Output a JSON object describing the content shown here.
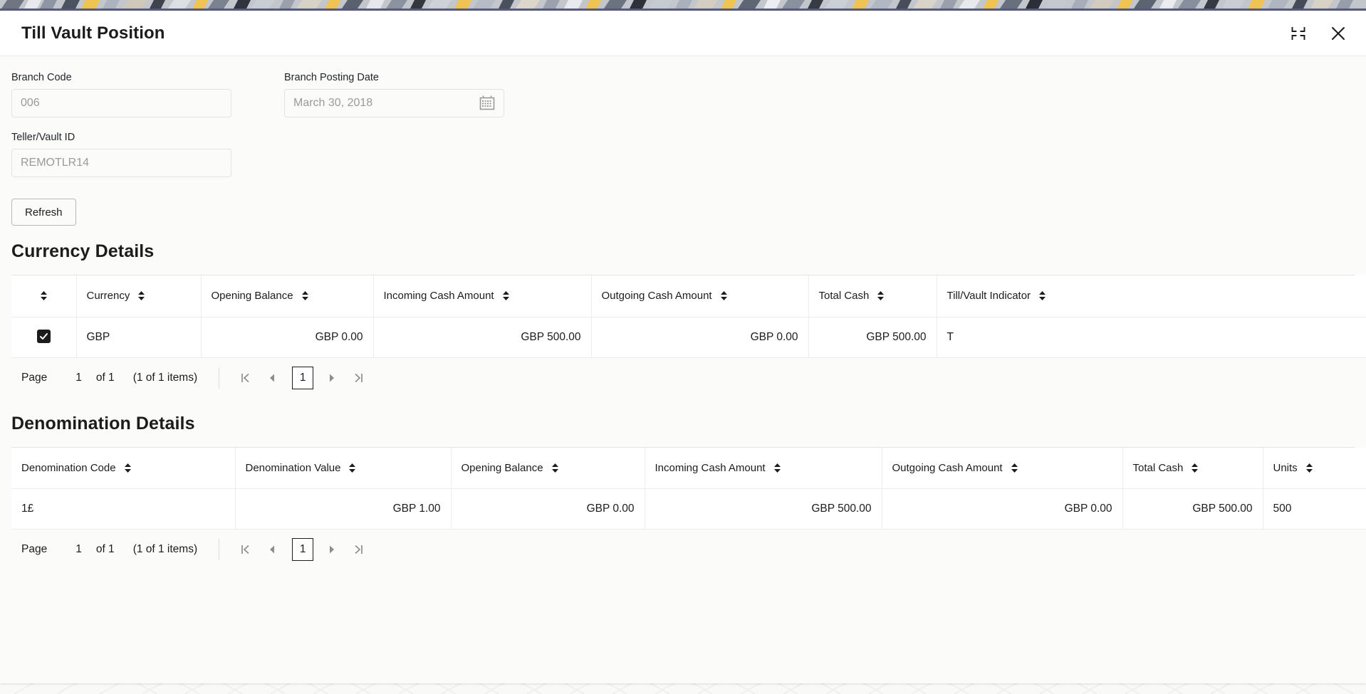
{
  "window": {
    "title": "Till Vault Position",
    "minimize_icon": "collapse-icon",
    "close_icon": "close-icon"
  },
  "form": {
    "branch_code": {
      "label": "Branch Code",
      "value": "006"
    },
    "branch_posting_date": {
      "label": "Branch Posting Date",
      "value": "March 30, 2018",
      "icon": "calendar-icon"
    },
    "teller_vault_id": {
      "label": "Teller/Vault ID",
      "value": "REMOTLR14"
    },
    "refresh_label": "Refresh"
  },
  "currency_details": {
    "heading": "Currency Details",
    "columns": [
      {
        "label": "",
        "align": "left"
      },
      {
        "label": "Currency",
        "align": "left"
      },
      {
        "label": "Opening Balance",
        "align": "right"
      },
      {
        "label": "Incoming Cash Amount",
        "align": "right"
      },
      {
        "label": "Outgoing Cash Amount",
        "align": "right"
      },
      {
        "label": "Total Cash",
        "align": "right"
      },
      {
        "label": "Till/Vault Indicator",
        "align": "left"
      }
    ],
    "rows": [
      {
        "selected": true,
        "currency": "GBP",
        "opening_balance": "GBP 0.00",
        "incoming_cash_amount": "GBP 500.00",
        "outgoing_cash_amount": "GBP 0.00",
        "total_cash": "GBP 500.00",
        "till_vault_indicator": "T"
      }
    ],
    "pager": {
      "page_label": "Page",
      "page_number": "1",
      "of_label": "of 1",
      "items_label": "(1 of 1 items)",
      "current_page": "1",
      "first_icon": "first-page-icon",
      "prev_icon": "prev-page-icon",
      "next_icon": "next-page-icon",
      "last_icon": "last-page-icon"
    }
  },
  "denomination_details": {
    "heading": "Denomination Details",
    "columns": [
      {
        "label": "Denomination Code",
        "align": "left"
      },
      {
        "label": "Denomination Value",
        "align": "right"
      },
      {
        "label": "Opening Balance",
        "align": "right"
      },
      {
        "label": "Incoming Cash Amount",
        "align": "right"
      },
      {
        "label": "Outgoing Cash Amount",
        "align": "right"
      },
      {
        "label": "Total Cash",
        "align": "right"
      },
      {
        "label": "Units",
        "align": "left"
      }
    ],
    "rows": [
      {
        "denomination_code": "1£",
        "denomination_value": "GBP 1.00",
        "opening_balance": "GBP 0.00",
        "incoming_cash_amount": "GBP 500.00",
        "outgoing_cash_amount": "GBP 0.00",
        "total_cash": "GBP 500.00",
        "units": "500"
      }
    ],
    "pager": {
      "page_label": "Page",
      "page_number": "1",
      "of_label": "of 1",
      "items_label": "(1 of 1 items)",
      "current_page": "1",
      "first_icon": "first-page-icon",
      "prev_icon": "prev-page-icon",
      "next_icon": "next-page-icon",
      "last_icon": "last-page-icon"
    }
  },
  "colors": {
    "modal_top_accent": "#565a7d",
    "page_background": "#f9f9f7",
    "checkbox": "#1c1c1c",
    "text": "#1c1c1c",
    "muted_text": "#9a9a9a",
    "border": "#ececea"
  }
}
